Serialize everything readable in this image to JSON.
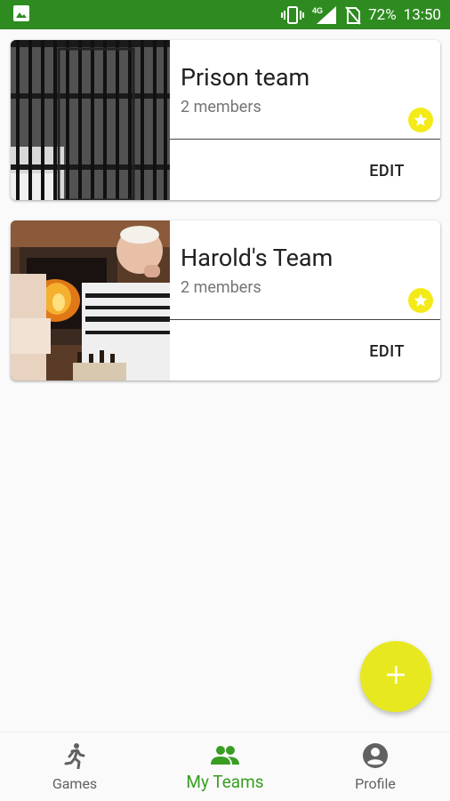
{
  "status_bar": {
    "battery": "72%",
    "time": "13:50",
    "network": "4G",
    "icons": [
      "image-icon",
      "vibrate-icon",
      "signal-icon",
      "no-sim-icon"
    ]
  },
  "teams": [
    {
      "name": "Prison team",
      "members": "2 members",
      "edit_label": "EDIT",
      "favorite": true,
      "image": "prison-bars-photo"
    },
    {
      "name": "Harold's Team",
      "members": "2 members",
      "edit_label": "EDIT",
      "favorite": true,
      "image": "fireplace-chess-photo"
    }
  ],
  "fab": {
    "icon": "plus-icon"
  },
  "bottom_nav": {
    "items": [
      {
        "label": "Games",
        "icon": "running-person-icon",
        "active": false
      },
      {
        "label": "My Teams",
        "icon": "group-icon",
        "active": true
      },
      {
        "label": "Profile",
        "icon": "account-circle-icon",
        "active": false
      }
    ]
  },
  "colors": {
    "status_bar": "#2e8b20",
    "accent": "#3a9d23",
    "fab": "#e8e820",
    "star_badge": "#f3ea18"
  }
}
